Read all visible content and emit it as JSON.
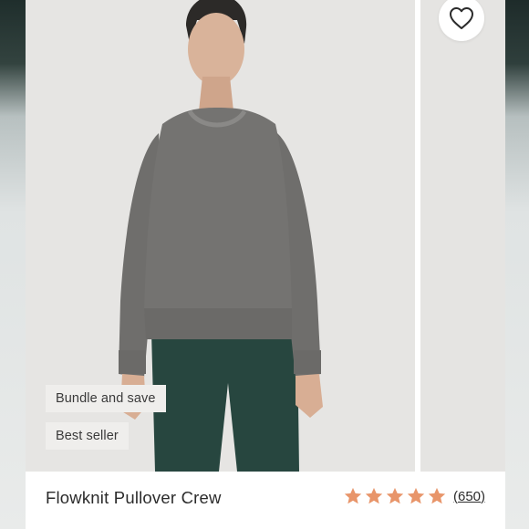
{
  "product": {
    "title": "Flowknit Pullover Crew",
    "review_count": "(650)",
    "rating": 5,
    "rating_max": 5
  },
  "badges": [
    {
      "label": "Bundle and save"
    },
    {
      "label": "Best seller"
    }
  ],
  "icons": {
    "favorite": "heart-outline-icon",
    "rating_star": "star-icon"
  },
  "colors": {
    "star": "#e8956a",
    "sweater": "#727170",
    "leggings": "#27463f",
    "photo_background": "#e6e5e3"
  }
}
